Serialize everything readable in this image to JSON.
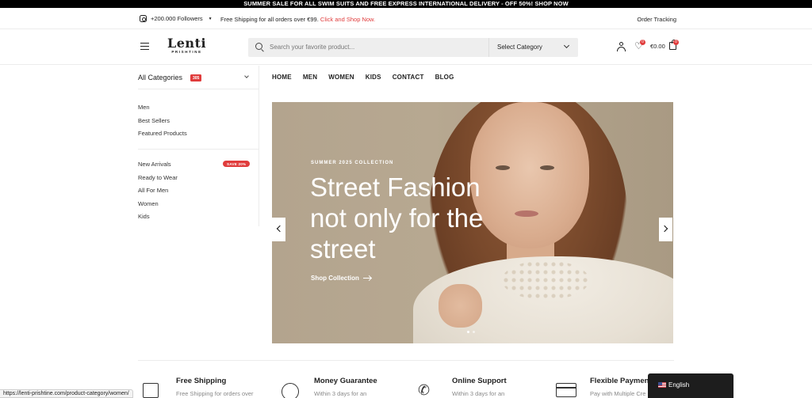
{
  "promo_bar": {
    "text": "SUMMER SALE FOR ALL SWIM SUITS AND FREE EXPRESS INTERNATIONAL DELIVERY - OFF 50%! SHOP NOW"
  },
  "topbar": {
    "followers": "+200.000 Followers",
    "shipping_text": "Free Shipping for all orders over €99.",
    "shipping_link": "Click and Shop Now.",
    "order_tracking": "Order Tracking"
  },
  "header": {
    "logo_name": "Lenti",
    "logo_sub": "PRISHTINE",
    "search_placeholder": "Search your favorite product...",
    "category_select": "Select Category",
    "wishlist_count": "0",
    "cart_total": "€0.00",
    "cart_count": "0"
  },
  "categories": {
    "title": "All Categories",
    "count": "305",
    "items_top": [
      "Men",
      "Best Sellers",
      "Featured Products"
    ],
    "items_bottom": [
      "New Arrivals",
      "Ready to Wear",
      "All For Men",
      "Women",
      "Kids"
    ],
    "sale_badge": "SAVE 20%"
  },
  "nav": {
    "items": [
      "HOME",
      "MEN",
      "WOMEN",
      "KIDS",
      "CONTACT",
      "BLOG"
    ]
  },
  "hero": {
    "eyebrow": "SUMMER 2025 COLLECTION",
    "headline": "Street Fashion not only for the street",
    "cta": "Shop Collection",
    "slide_count": 2,
    "active_slide": 1
  },
  "features": [
    {
      "title": "Free Shipping",
      "desc": "Free Shipping for orders over"
    },
    {
      "title": "Money Guarantee",
      "desc": "Within 3 days for an"
    },
    {
      "title": "Online Support",
      "desc": "Within 3 days for an"
    },
    {
      "title": "Flexible Payment",
      "desc": "Pay with Multiple Cre"
    }
  ],
  "language": {
    "label": "English"
  },
  "status_url": "https://lenti-prishtine.com/product-category/women/",
  "colors": {
    "accent_red": "#e03c3c",
    "promo_bg": "#000000",
    "hero_bg": "#b8aa95"
  }
}
